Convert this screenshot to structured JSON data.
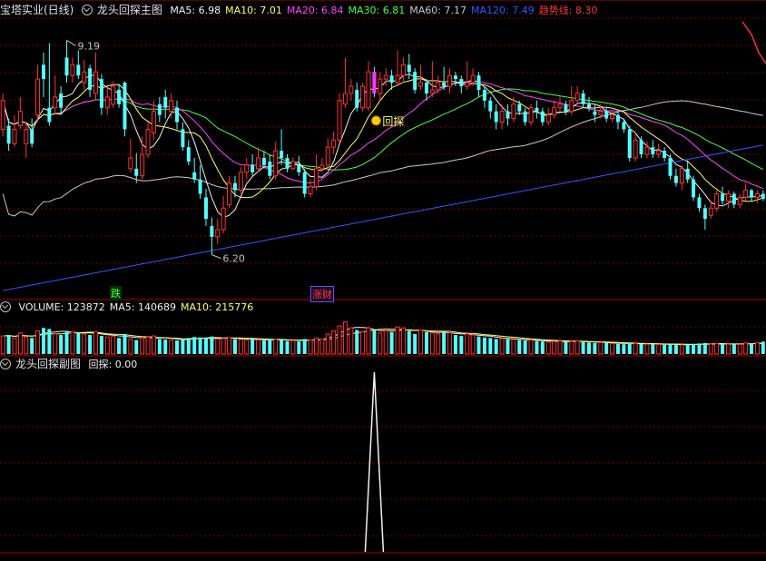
{
  "main_panel": {
    "stock_name": "宝塔实业(日线)",
    "indicator_name": "龙头回探主图",
    "legend": [
      {
        "label": "MA5",
        "value": "6.98",
        "color": "#f0f0f0"
      },
      {
        "label": "MA10",
        "value": "7.01",
        "color": "#ffff66"
      },
      {
        "label": "MA20",
        "value": "6.84",
        "color": "#ff44ff"
      },
      {
        "label": "MA30",
        "value": "6.81",
        "color": "#44ff44"
      },
      {
        "label": "MA60",
        "value": "7.17",
        "color": "#c8c8c8"
      },
      {
        "label": "MA120",
        "value": "7.49",
        "color": "#3355ff"
      },
      {
        "label": "趋势线",
        "value": "8.30",
        "color": "#ff3333"
      }
    ],
    "high_label": "9.19",
    "low_label": "6.20",
    "signal_label": "回探",
    "down_tag": "跌",
    "up_tag": "涨财"
  },
  "volume_panel": {
    "legend": [
      {
        "label": "VOLUME",
        "value": "123872",
        "color": "#f0f0f0"
      },
      {
        "label": "MA5",
        "value": "140689",
        "color": "#f0f0f0"
      },
      {
        "label": "MA10",
        "value": "215776",
        "color": "#ffff66"
      }
    ]
  },
  "sub_panel": {
    "indicator_name": "龙头回探副图",
    "legend": [
      {
        "label": "回探",
        "value": "0.00",
        "color": "#f0f0f0"
      }
    ]
  },
  "colors": {
    "up": "#ff3333",
    "down": "#54ffff",
    "grid": "#7a0000",
    "signal_bar": "#ff33ff"
  },
  "chart_data": {
    "type": "candlestick",
    "price_range": [
      5.6,
      9.5
    ],
    "volume_range": [
      0,
      380000
    ],
    "sub_range": [
      0,
      1
    ],
    "candles": [
      [
        7.95,
        8.35,
        8.45,
        7.85
      ],
      [
        8.0,
        7.75,
        8.1,
        7.65
      ],
      [
        7.75,
        7.95,
        8.15,
        7.7
      ],
      [
        8.0,
        8.2,
        8.4,
        7.95
      ],
      [
        7.75,
        7.95,
        8.05,
        7.55
      ],
      [
        7.95,
        7.75,
        8.1,
        7.7
      ],
      [
        8.15,
        8.65,
        8.85,
        8.05
      ],
      [
        8.85,
        8.65,
        9.02,
        8.4
      ],
      [
        8.25,
        8.05,
        9.15,
        8.0
      ],
      [
        8.25,
        8.4,
        8.7,
        8.15
      ],
      [
        8.45,
        8.25,
        8.55,
        8.15
      ],
      [
        8.95,
        8.7,
        9.19,
        8.6
      ],
      [
        8.7,
        8.85,
        8.95,
        8.6
      ],
      [
        8.85,
        8.7,
        9.05,
        8.65
      ],
      [
        8.6,
        8.75,
        8.92,
        8.5
      ],
      [
        8.8,
        8.5,
        8.85,
        8.4
      ],
      [
        8.45,
        8.75,
        9.02,
        8.35
      ],
      [
        8.65,
        8.25,
        8.72,
        8.15
      ],
      [
        8.25,
        8.4,
        8.55,
        8.15
      ],
      [
        8.3,
        8.55,
        8.62,
        8.25
      ],
      [
        8.5,
        8.3,
        8.58,
        8.25
      ],
      [
        8.6,
        7.95,
        8.62,
        7.85
      ],
      [
        7.4,
        7.55,
        7.82,
        7.35
      ],
      [
        7.4,
        7.3,
        7.62,
        7.2
      ],
      [
        7.3,
        7.6,
        7.85,
        7.25
      ],
      [
        7.6,
        7.95,
        8.05,
        7.55
      ],
      [
        7.9,
        8.2,
        8.35,
        7.8
      ],
      [
        8.3,
        8.15,
        8.4,
        8.05
      ],
      [
        8.4,
        8.25,
        8.5,
        8.1
      ],
      [
        8.2,
        8.35,
        8.45,
        8.1
      ],
      [
        8.25,
        8.05,
        8.35,
        7.95
      ],
      [
        7.95,
        7.7,
        8.05,
        7.65
      ],
      [
        7.7,
        7.5,
        7.8,
        7.45
      ],
      [
        7.35,
        7.25,
        7.55,
        7.2
      ],
      [
        7.25,
        7.05,
        7.45,
        6.98
      ],
      [
        7.0,
        6.7,
        7.12,
        6.6
      ],
      [
        6.6,
        6.45,
        6.72,
        6.2
      ],
      [
        6.45,
        6.55,
        6.7,
        6.35
      ],
      [
        6.55,
        6.85,
        7.02,
        6.5
      ],
      [
        6.9,
        7.2,
        7.3,
        6.85
      ],
      [
        7.2,
        7.1,
        7.3,
        7.0
      ],
      [
        7.1,
        7.35,
        7.42,
        7.05
      ],
      [
        7.35,
        7.45,
        7.55,
        7.25
      ],
      [
        7.45,
        7.35,
        7.6,
        7.3
      ],
      [
        7.4,
        7.55,
        7.7,
        7.35
      ],
      [
        7.55,
        7.45,
        7.65,
        7.4
      ],
      [
        7.5,
        7.3,
        7.6,
        7.25
      ],
      [
        7.3,
        7.65,
        7.78,
        7.25
      ],
      [
        7.65,
        7.55,
        7.95,
        7.45
      ],
      [
        7.55,
        7.4,
        7.6,
        7.35
      ],
      [
        7.4,
        7.5,
        7.56,
        7.38
      ],
      [
        7.45,
        7.35,
        7.58,
        7.3
      ],
      [
        7.35,
        7.05,
        7.4,
        7.0
      ],
      [
        7.05,
        7.15,
        7.25,
        7.0
      ],
      [
        7.15,
        7.4,
        7.6,
        7.1
      ],
      [
        7.4,
        7.45,
        7.55,
        7.35
      ],
      [
        7.45,
        7.7,
        7.82,
        7.4
      ],
      [
        7.7,
        7.8,
        7.92,
        7.6
      ],
      [
        7.8,
        8.35,
        8.45,
        7.75
      ],
      [
        8.3,
        8.45,
        8.95,
        8.25
      ],
      [
        8.45,
        8.55,
        8.65,
        8.35
      ],
      [
        8.5,
        8.25,
        8.6,
        8.2
      ],
      [
        8.25,
        8.55,
        8.6,
        8.2
      ],
      [
        8.25,
        8.75,
        8.9,
        8.2
      ],
      [
        8.75,
        8.45,
        8.82,
        8.4
      ],
      [
        8.45,
        8.65,
        8.75,
        8.35
      ],
      [
        8.65,
        8.7,
        8.8,
        8.55
      ],
      [
        8.7,
        8.6,
        8.78,
        8.5
      ],
      [
        8.6,
        8.7,
        9.05,
        8.55
      ],
      [
        8.7,
        8.85,
        8.95,
        8.6
      ],
      [
        8.85,
        8.75,
        9.0,
        8.65
      ],
      [
        8.75,
        8.5,
        8.8,
        8.45
      ],
      [
        8.55,
        8.6,
        8.85,
        8.5
      ],
      [
        8.6,
        8.45,
        8.65,
        8.35
      ],
      [
        8.45,
        8.5,
        8.9,
        8.4
      ],
      [
        8.5,
        8.6,
        8.7,
        8.45
      ],
      [
        8.6,
        8.55,
        8.82,
        8.5
      ],
      [
        8.55,
        8.7,
        8.8,
        8.45
      ],
      [
        8.7,
        8.65,
        8.75,
        8.55
      ],
      [
        8.65,
        8.55,
        8.7,
        8.45
      ],
      [
        8.55,
        8.6,
        8.9,
        8.5
      ],
      [
        8.6,
        8.7,
        8.8,
        8.55
      ],
      [
        8.7,
        8.5,
        8.75,
        8.4
      ],
      [
        8.5,
        8.35,
        8.55,
        8.25
      ],
      [
        8.35,
        8.2,
        8.4,
        8.1
      ],
      [
        8.2,
        8.05,
        8.3,
        7.95
      ],
      [
        8.05,
        8.2,
        8.3,
        7.95
      ],
      [
        8.2,
        8.1,
        8.3,
        8.0
      ],
      [
        8.1,
        8.3,
        8.4,
        8.05
      ],
      [
        8.3,
        8.2,
        8.35,
        8.15
      ],
      [
        8.2,
        8.05,
        8.25,
        8.0
      ],
      [
        8.05,
        8.25,
        8.3,
        8.0
      ],
      [
        8.25,
        8.2,
        8.35,
        8.1
      ],
      [
        8.2,
        8.05,
        8.25,
        8.0
      ],
      [
        8.05,
        8.15,
        8.25,
        8.0
      ],
      [
        8.15,
        8.25,
        8.35,
        8.1
      ],
      [
        8.25,
        8.3,
        8.4,
        8.2
      ],
      [
        8.3,
        8.2,
        8.35,
        8.15
      ],
      [
        8.2,
        8.35,
        8.55,
        8.15
      ],
      [
        8.35,
        8.45,
        8.55,
        8.3
      ],
      [
        8.45,
        8.3,
        8.5,
        8.25
      ],
      [
        8.3,
        8.25,
        8.4,
        8.2
      ],
      [
        8.2,
        8.15,
        8.3,
        8.05
      ],
      [
        8.15,
        8.2,
        8.3,
        8.1
      ],
      [
        8.2,
        8.1,
        8.25,
        8.05
      ],
      [
        8.1,
        8.15,
        8.2,
        8.05
      ],
      [
        8.15,
        8.05,
        8.2,
        7.95
      ],
      [
        8.05,
        7.95,
        8.1,
        7.9
      ],
      [
        7.95,
        7.55,
        8.0,
        7.5
      ],
      [
        7.55,
        7.8,
        7.9,
        7.5
      ],
      [
        7.8,
        7.6,
        7.85,
        7.55
      ],
      [
        7.6,
        7.7,
        7.78,
        7.55
      ],
      [
        7.7,
        7.6,
        7.8,
        7.55
      ],
      [
        7.6,
        7.65,
        7.75,
        7.55
      ],
      [
        7.65,
        7.55,
        7.7,
        7.5
      ],
      [
        7.55,
        7.3,
        7.6,
        7.25
      ],
      [
        7.3,
        7.2,
        7.4,
        7.15
      ],
      [
        7.2,
        7.4,
        7.45,
        7.1
      ],
      [
        7.4,
        7.25,
        7.5,
        7.2
      ],
      [
        7.25,
        7.0,
        7.3,
        6.95
      ],
      [
        7.0,
        6.85,
        7.05,
        6.8
      ],
      [
        6.85,
        6.7,
        6.9,
        6.55
      ],
      [
        6.75,
        6.85,
        6.95,
        6.7
      ],
      [
        6.85,
        7.05,
        7.1,
        6.8
      ],
      [
        7.05,
        6.95,
        7.15,
        6.9
      ],
      [
        6.95,
        7.05,
        7.1,
        6.85
      ],
      [
        7.05,
        6.9,
        7.08,
        6.85
      ],
      [
        6.9,
        7.0,
        7.05,
        6.85
      ],
      [
        7.0,
        7.1,
        7.2,
        6.95
      ],
      [
        7.1,
        7.0,
        7.12,
        6.95
      ],
      [
        7.0,
        7.05,
        7.1,
        6.92
      ],
      [
        7.05,
        6.98,
        7.1,
        6.95
      ]
    ],
    "volume": [
      180000,
      190000,
      160000,
      210000,
      170000,
      160000,
      230000,
      260000,
      250000,
      200000,
      190000,
      230000,
      220000,
      210000,
      200000,
      190000,
      220000,
      180000,
      170000,
      175000,
      160000,
      200000,
      150000,
      140000,
      160000,
      170000,
      180000,
      150000,
      145000,
      140000,
      135000,
      150000,
      160000,
      170000,
      165000,
      160000,
      175000,
      150000,
      155000,
      165000,
      150000,
      145000,
      140000,
      150000,
      140000,
      135000,
      150000,
      145000,
      140000,
      130000,
      135000,
      125000,
      150000,
      140000,
      160000,
      150000,
      200000,
      230000,
      280000,
      320000,
      260000,
      240000,
      220000,
      260000,
      240000,
      210000,
      230000,
      220000,
      270000,
      260000,
      230000,
      200000,
      240000,
      220000,
      210000,
      200000,
      220000,
      210000,
      190000,
      180000,
      200000,
      190000,
      175000,
      165000,
      160000,
      150000,
      155000,
      150000,
      145000,
      140000,
      135000,
      140000,
      130000,
      125000,
      120000,
      125000,
      130000,
      120000,
      125000,
      130000,
      120000,
      115000,
      110000,
      115000,
      110000,
      105000,
      100000,
      98000,
      110000,
      105000,
      100000,
      98000,
      100000,
      95000,
      92000,
      98000,
      95000,
      90000,
      95000,
      100000,
      105000,
      110000,
      100000,
      105000,
      100000,
      98000,
      100000,
      95000,
      110000,
      105000,
      115000,
      123872
    ],
    "signal": {
      "index": 64,
      "value": 1
    }
  }
}
